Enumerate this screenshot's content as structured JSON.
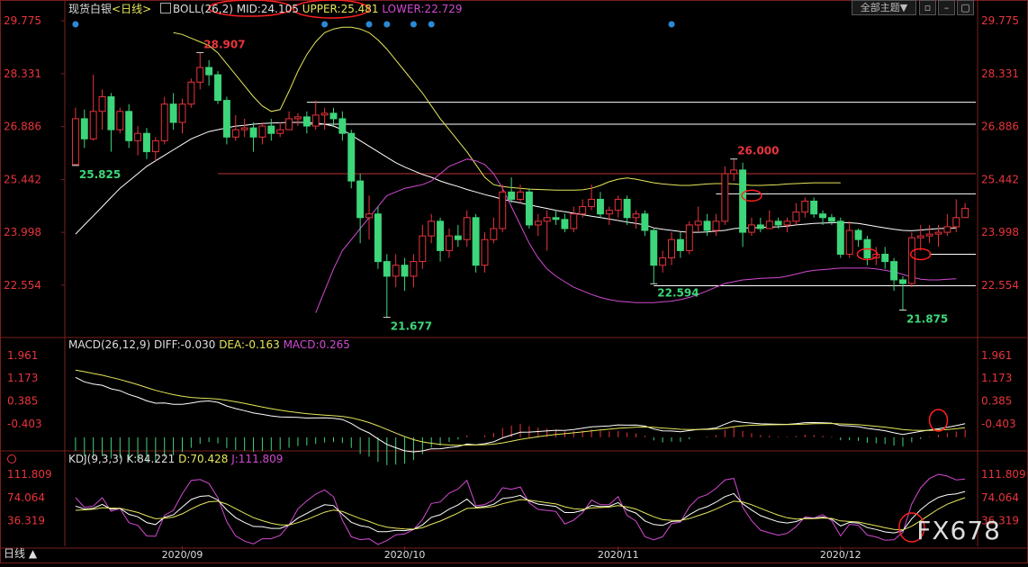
{
  "header": {
    "instrument": "现货白银",
    "period": "<日线>",
    "indicator_icon": "indicator-icon",
    "boll_label": "BOLL(26,2)",
    "mid": "MID:24.105",
    "upper": "UPPER:25.481",
    "lower": "LOWER:22.729",
    "theme_button": "全部主题▼"
  },
  "macd_header": {
    "label": "MACD(26,12,9)",
    "diff": "DIFF:-0.030",
    "dea": "DEA:-0.163",
    "macd": "MACD:0.265"
  },
  "kdj_header": {
    "label": "KDJ(9,3,3)",
    "k": "K:84.221",
    "d": "D:70.428",
    "j": "J:111.809"
  },
  "footer": {
    "period_tab": "日线 ▲",
    "watermark": "FX678"
  },
  "colors": {
    "up": "#e8343c",
    "down": "#3dd67a",
    "mid": "#ffffff",
    "upper": "#e6e65a",
    "lower": "#d24ad2",
    "axis_text": "#e8343c",
    "grid": "#7a1f1f"
  },
  "chart_data": [
    {
      "type": "candlestick",
      "name": "price",
      "y_ticks": [
        29.775,
        28.331,
        26.886,
        25.442,
        23.998,
        22.554
      ],
      "ylim": [
        21.2,
        29.9
      ],
      "x_ticks": [
        {
          "label": "2020/09",
          "index": 12
        },
        {
          "label": "2020/10",
          "index": 37
        },
        {
          "label": "2020/11",
          "index": 61
        },
        {
          "label": "2020/12",
          "index": 86
        }
      ],
      "candles": [
        [
          25.85,
          27.1,
          27.4,
          25.83
        ],
        [
          27.1,
          26.55,
          27.35,
          26.3
        ],
        [
          26.55,
          27.3,
          28.3,
          26.5
        ],
        [
          27.3,
          27.7,
          27.9,
          26.8
        ],
        [
          27.7,
          26.8,
          27.8,
          26.2
        ],
        [
          26.8,
          27.3,
          27.4,
          26.7
        ],
        [
          27.3,
          26.5,
          27.5,
          26.3
        ],
        [
          26.5,
          26.7,
          26.9,
          26.1
        ],
        [
          26.7,
          26.2,
          26.85,
          26.0
        ],
        [
          26.2,
          26.5,
          26.6,
          25.95
        ],
        [
          26.5,
          27.5,
          27.7,
          26.4
        ],
        [
          27.5,
          27.0,
          27.8,
          26.8
        ],
        [
          27.0,
          27.5,
          27.65,
          26.7
        ],
        [
          27.5,
          28.1,
          28.2,
          27.4
        ],
        [
          28.1,
          28.5,
          28.907,
          27.9
        ],
        [
          28.5,
          28.3,
          28.7,
          28.0
        ],
        [
          28.3,
          27.6,
          28.4,
          27.5
        ],
        [
          27.6,
          26.6,
          27.7,
          26.4
        ],
        [
          26.6,
          26.8,
          27.2,
          26.5
        ],
        [
          26.8,
          26.85,
          27.1,
          26.6
        ],
        [
          26.85,
          26.6,
          27.0,
          26.2
        ],
        [
          26.6,
          26.9,
          27.0,
          26.4
        ],
        [
          26.9,
          26.7,
          27.1,
          26.5
        ],
        [
          26.7,
          26.8,
          27.0,
          26.6
        ],
        [
          26.8,
          27.1,
          27.3,
          26.8
        ],
        [
          27.1,
          27.15,
          27.25,
          26.9
        ],
        [
          27.15,
          26.9,
          27.3,
          26.7
        ],
        [
          26.9,
          27.2,
          27.6,
          26.8
        ],
        [
          27.2,
          27.25,
          27.4,
          26.8
        ],
        [
          27.25,
          27.1,
          27.4,
          26.9
        ],
        [
          27.1,
          26.7,
          27.3,
          26.5
        ],
        [
          26.7,
          25.4,
          26.8,
          25.2
        ],
        [
          25.4,
          24.4,
          25.6,
          23.7
        ],
        [
          24.4,
          24.5,
          25.0,
          23.8
        ],
        [
          24.5,
          23.2,
          24.7,
          23.0
        ],
        [
          23.2,
          22.8,
          23.4,
          21.677
        ],
        [
          22.8,
          23.1,
          23.4,
          22.5
        ],
        [
          23.1,
          22.8,
          23.3,
          22.4
        ],
        [
          22.8,
          23.2,
          23.4,
          22.5
        ],
        [
          23.2,
          23.9,
          24.2,
          23.0
        ],
        [
          23.9,
          24.3,
          24.5,
          23.7
        ],
        [
          24.3,
          23.5,
          24.4,
          23.2
        ],
        [
          23.5,
          23.9,
          24.1,
          23.3
        ],
        [
          23.9,
          23.8,
          24.2,
          23.6
        ],
        [
          23.8,
          24.4,
          24.6,
          23.6
        ],
        [
          24.4,
          23.1,
          24.5,
          22.9
        ],
        [
          23.1,
          23.8,
          24.0,
          22.9
        ],
        [
          23.8,
          24.1,
          24.4,
          23.7
        ],
        [
          24.1,
          25.1,
          25.3,
          24.0
        ],
        [
          25.1,
          24.9,
          25.5,
          24.8
        ],
        [
          24.9,
          25.1,
          25.3,
          24.8
        ],
        [
          25.1,
          24.2,
          25.2,
          24.1
        ],
        [
          24.2,
          24.3,
          24.5,
          23.9
        ],
        [
          24.3,
          24.4,
          24.6,
          23.5
        ],
        [
          24.4,
          24.35,
          24.6,
          24.2
        ],
        [
          24.35,
          24.1,
          24.5,
          24.0
        ],
        [
          24.1,
          24.5,
          24.7,
          24.0
        ],
        [
          24.5,
          24.7,
          24.9,
          24.4
        ],
        [
          24.7,
          24.9,
          25.3,
          24.6
        ],
        [
          24.9,
          24.5,
          25.1,
          24.4
        ],
        [
          24.5,
          24.6,
          24.7,
          24.2
        ],
        [
          24.6,
          24.9,
          25.0,
          24.4
        ],
        [
          24.9,
          24.4,
          25.0,
          24.2
        ],
        [
          24.4,
          24.5,
          24.6,
          24.1
        ],
        [
          24.5,
          24.05,
          24.6,
          23.9
        ],
        [
          24.05,
          23.1,
          24.1,
          22.594
        ],
        [
          23.1,
          23.3,
          23.5,
          22.9
        ],
        [
          23.3,
          23.8,
          24.0,
          23.1
        ],
        [
          23.8,
          23.5,
          24.0,
          23.3
        ],
        [
          23.5,
          24.2,
          24.3,
          23.4
        ],
        [
          24.2,
          24.3,
          24.7,
          24.0
        ],
        [
          24.3,
          24.05,
          24.5,
          23.9
        ],
        [
          24.05,
          24.3,
          24.5,
          23.9
        ],
        [
          24.3,
          25.6,
          25.8,
          24.2
        ],
        [
          25.6,
          25.7,
          26.0,
          25.4
        ],
        [
          25.7,
          24.0,
          25.9,
          23.6
        ],
        [
          24.0,
          24.2,
          24.4,
          23.9
        ],
        [
          24.2,
          24.1,
          24.4,
          24.0
        ],
        [
          24.1,
          24.3,
          24.6,
          24.1
        ],
        [
          24.3,
          24.2,
          24.4,
          24.1
        ],
        [
          24.2,
          24.3,
          24.4,
          24.0
        ],
        [
          24.3,
          24.55,
          24.8,
          24.2
        ],
        [
          24.55,
          24.85,
          24.95,
          24.4
        ],
        [
          24.85,
          24.5,
          24.95,
          24.4
        ],
        [
          24.5,
          24.4,
          24.6,
          24.2
        ],
        [
          24.4,
          24.3,
          24.5,
          24.2
        ],
        [
          24.3,
          23.4,
          24.4,
          23.3
        ],
        [
          23.4,
          24.05,
          24.3,
          23.3
        ],
        [
          24.05,
          23.8,
          24.1,
          23.6
        ],
        [
          23.8,
          23.3,
          23.9,
          23.1
        ],
        [
          23.3,
          23.4,
          23.6,
          23.1
        ],
        [
          23.4,
          23.2,
          23.6,
          23.0
        ],
        [
          23.2,
          22.7,
          23.3,
          22.4
        ],
        [
          22.7,
          22.6,
          22.8,
          21.875
        ],
        [
          22.6,
          23.85,
          24.0,
          22.5
        ],
        [
          23.85,
          23.9,
          24.2,
          23.5
        ],
        [
          23.9,
          23.95,
          24.2,
          23.7
        ],
        [
          23.95,
          24.0,
          24.2,
          23.6
        ],
        [
          24.0,
          24.15,
          24.5,
          23.9
        ],
        [
          24.15,
          24.4,
          24.9,
          24.0
        ],
        [
          24.4,
          24.65,
          24.8,
          24.4
        ]
      ],
      "peak_labels": [
        {
          "index": 14,
          "value": 28.907,
          "text": "28.907",
          "color": "up"
        },
        {
          "index": 0,
          "value": 25.825,
          "text": "25.825",
          "color": "down"
        },
        {
          "index": 35,
          "value": 21.677,
          "text": "21.677",
          "color": "down"
        },
        {
          "index": 74,
          "value": 26.0,
          "text": "26.000",
          "color": "up"
        },
        {
          "index": 65,
          "value": 22.594,
          "text": "22.594",
          "color": "down"
        },
        {
          "index": 93,
          "value": 21.875,
          "text": "21.875",
          "color": "down"
        }
      ],
      "hlines": [
        {
          "value": 27.55,
          "from": 26,
          "to": 104,
          "color": "#ffffff"
        },
        {
          "value": 26.95,
          "from": 26,
          "to": 104,
          "color": "#ffffff"
        },
        {
          "value": 25.6,
          "from": 16,
          "to": 104,
          "color": "#c0302f"
        },
        {
          "value": 25.05,
          "from": 72,
          "to": 104,
          "color": "#ffffff"
        },
        {
          "value": 23.4,
          "from": 96,
          "to": 104,
          "color": "#ffffff"
        },
        {
          "value": 22.54,
          "from": 65,
          "to": 104,
          "color": "#ffffff"
        }
      ],
      "marker_dots_at": [
        0,
        28,
        33,
        35,
        38,
        40,
        67
      ],
      "circles": [
        {
          "index": 76,
          "value": 25.0
        },
        {
          "index": 89,
          "value": 23.4
        },
        {
          "index": 95,
          "value": 23.4
        }
      ],
      "boll": {
        "mid": [
          23.95,
          24.2,
          24.45,
          24.7,
          24.95,
          25.2,
          25.4,
          25.6,
          25.8,
          25.95,
          26.1,
          26.25,
          26.4,
          26.55,
          26.65,
          26.75,
          26.8,
          26.85,
          26.9,
          26.92,
          26.95,
          26.97,
          26.98,
          26.99,
          27.0,
          27.0,
          27.0,
          26.98,
          26.95,
          26.9,
          26.8,
          26.65,
          26.5,
          26.35,
          26.2,
          26.05,
          25.9,
          25.78,
          25.68,
          25.58,
          25.5,
          25.4,
          25.32,
          25.25,
          25.17,
          25.1,
          25.03,
          24.97,
          24.9,
          24.85,
          24.8,
          24.75,
          24.7,
          24.65,
          24.6,
          24.56,
          24.52,
          24.48,
          24.44,
          24.4,
          24.36,
          24.32,
          24.28,
          24.24,
          24.2,
          24.12,
          24.08,
          24.05,
          24.02,
          24.0,
          24.0,
          24.01,
          24.03,
          24.05,
          24.1,
          24.12,
          24.12,
          24.13,
          24.14,
          24.15,
          24.17,
          24.2,
          24.22,
          24.24,
          24.25,
          24.26,
          24.27,
          24.26,
          24.24,
          24.2,
          24.16,
          24.12,
          24.08,
          24.05,
          24.04,
          24.06,
          24.08,
          24.1,
          24.11,
          24.12
        ],
        "upper": [
          null,
          null,
          null,
          null,
          null,
          null,
          null,
          null,
          null,
          null,
          null,
          29.45,
          29.4,
          29.3,
          29.2,
          29.1,
          28.9,
          28.6,
          28.3,
          28.0,
          27.7,
          27.45,
          27.3,
          27.35,
          27.85,
          28.4,
          28.85,
          29.2,
          29.45,
          29.55,
          29.6,
          29.6,
          29.55,
          29.45,
          29.25,
          29.0,
          28.7,
          28.4,
          28.1,
          27.8,
          27.45,
          27.1,
          26.8,
          26.5,
          26.2,
          25.85,
          25.5,
          25.3,
          25.25,
          25.22,
          25.2,
          25.18,
          25.17,
          25.16,
          25.15,
          25.15,
          25.15,
          25.16,
          25.2,
          25.28,
          25.38,
          25.45,
          25.48,
          25.45,
          25.4,
          25.35,
          25.32,
          25.3,
          25.28,
          25.28,
          25.3,
          25.32,
          25.33,
          25.33,
          25.32,
          25.3,
          25.28,
          25.28,
          25.29,
          25.3,
          25.32,
          25.33,
          25.34,
          25.35,
          25.35,
          25.35,
          25.35
        ],
        "lower": [
          null,
          null,
          null,
          null,
          null,
          null,
          null,
          null,
          null,
          null,
          null,
          null,
          null,
          null,
          null,
          null,
          null,
          null,
          null,
          null,
          null,
          null,
          null,
          null,
          null,
          null,
          null,
          21.8,
          22.4,
          23.0,
          23.5,
          23.8,
          24.1,
          24.4,
          24.7,
          25.0,
          25.1,
          25.2,
          25.25,
          25.3,
          25.4,
          25.6,
          25.8,
          25.9,
          26.0,
          25.95,
          25.85,
          25.6,
          25.2,
          24.7,
          24.2,
          23.7,
          23.3,
          23.0,
          22.8,
          22.65,
          22.5,
          22.4,
          22.3,
          22.22,
          22.16,
          22.12,
          22.1,
          22.08,
          22.08,
          22.08,
          22.1,
          22.12,
          22.16,
          22.22,
          22.3,
          22.4,
          22.5,
          22.6,
          22.65,
          22.7,
          22.72,
          22.74,
          22.75,
          22.76,
          22.8,
          22.86,
          22.92,
          22.96,
          22.98,
          23.0,
          23.02,
          23.02,
          23.02,
          23.02,
          23.0,
          22.96,
          22.92,
          22.85,
          22.78,
          22.72,
          22.7,
          22.7,
          22.72,
          22.73
        ]
      }
    },
    {
      "type": "bar+line",
      "name": "macd",
      "y_ticks": [
        1.961,
        1.173,
        0.385,
        -0.403
      ],
      "ylim": [
        -1.25,
        2.05
      ]
    },
    {
      "type": "line",
      "name": "kdj",
      "y_ticks": [
        111.809,
        74.064,
        36.319
      ],
      "ylim": [
        -5,
        125
      ]
    }
  ]
}
